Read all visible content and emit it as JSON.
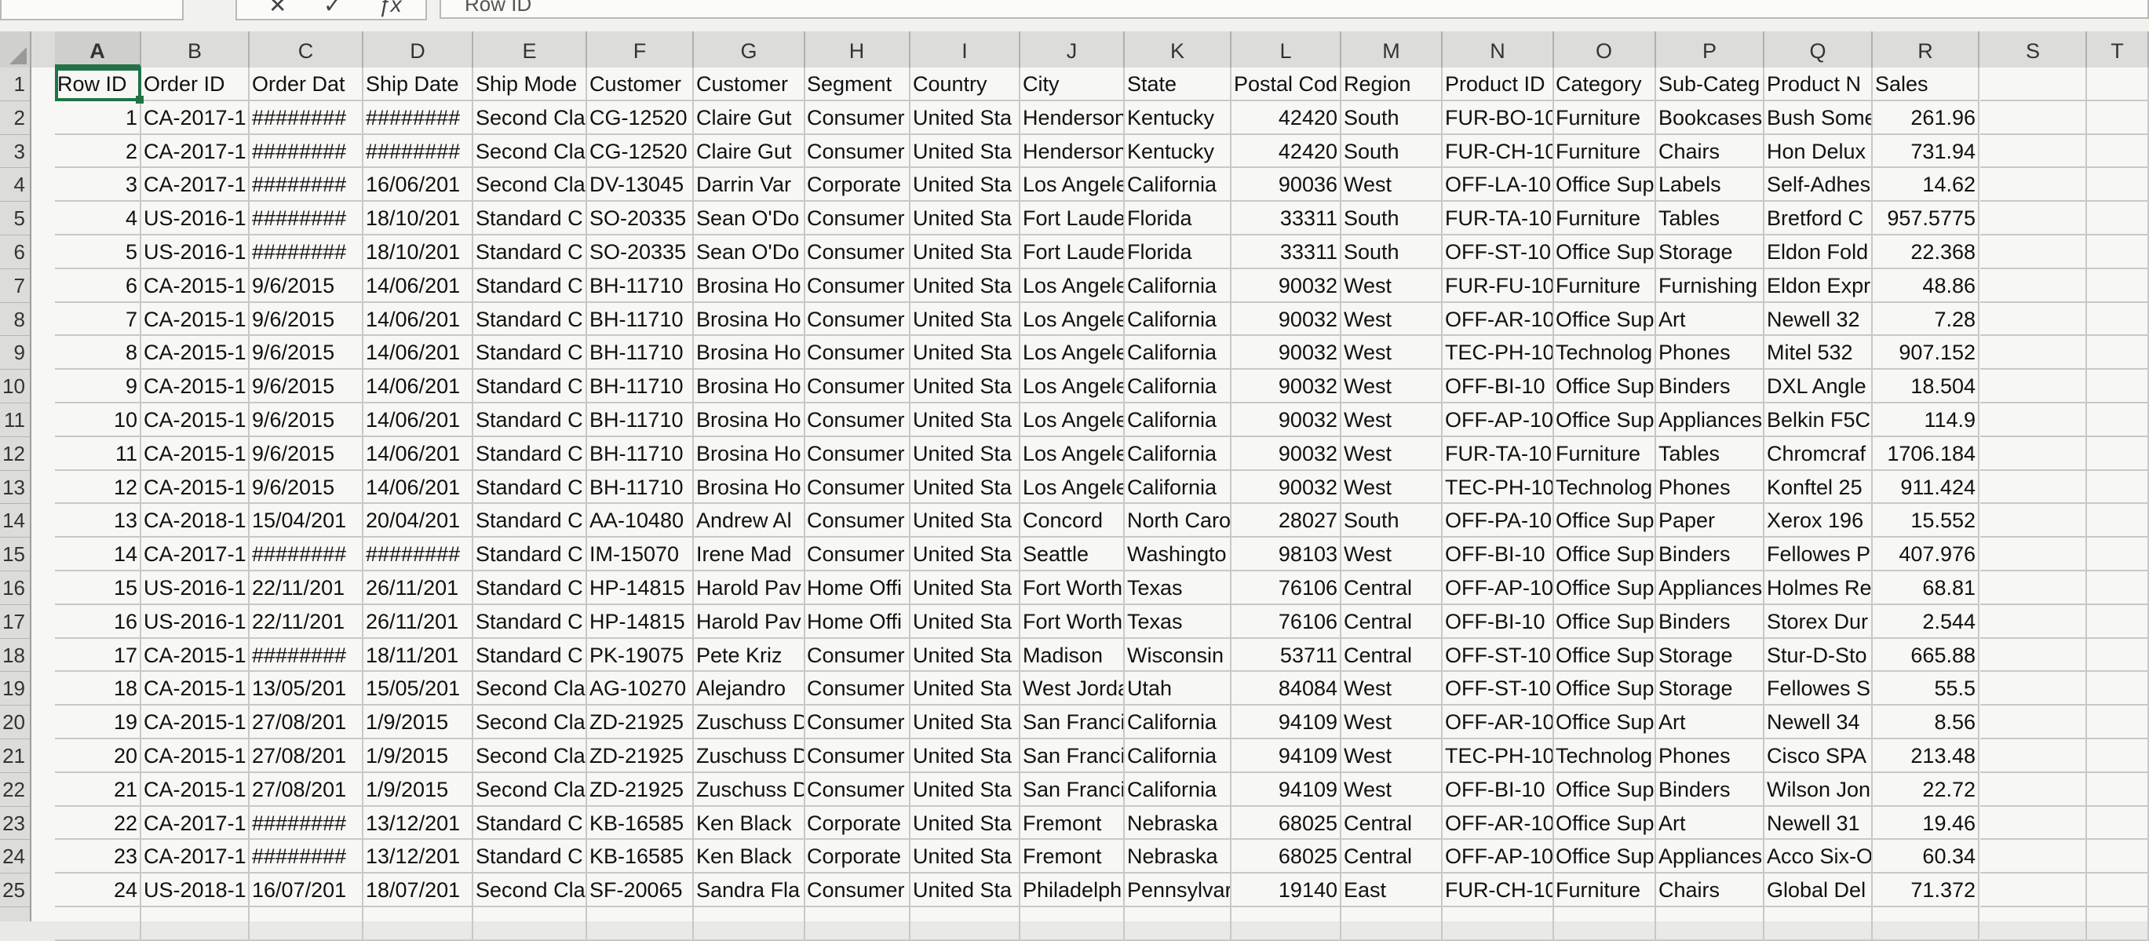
{
  "formula_bar": {
    "name_box": "",
    "formula_text": "Row ID"
  },
  "columns": [
    "A",
    "B",
    "C",
    "D",
    "E",
    "F",
    "G",
    "H",
    "I",
    "J",
    "K",
    "L",
    "M",
    "N",
    "O",
    "P",
    "Q",
    "R",
    "S",
    "T"
  ],
  "selected_column": "A",
  "active_cell": "A1",
  "rows": [
    [
      "Row ID",
      "Order ID",
      "Order Dat",
      "Ship Date",
      "Ship Mode",
      "Customer",
      "Customer",
      "Segment",
      "Country",
      "City",
      "State",
      "Postal Cod",
      "Region",
      "Product ID",
      "Category",
      "Sub-Categ",
      "Product N",
      "Sales"
    ],
    [
      "1",
      "CA-2017-1",
      "########",
      "########",
      "Second Cla",
      "CG-12520",
      "Claire Gut",
      "Consumer",
      "United Sta",
      "Henderson",
      "Kentucky",
      "42420",
      "South",
      "FUR-BO-10",
      "Furniture",
      "Bookcases",
      "Bush Some",
      "261.96"
    ],
    [
      "2",
      "CA-2017-1",
      "########",
      "########",
      "Second Cla",
      "CG-12520",
      "Claire Gut",
      "Consumer",
      "United Sta",
      "Henderson",
      "Kentucky",
      "42420",
      "South",
      "FUR-CH-10",
      "Furniture",
      "Chairs",
      "Hon Delux",
      "731.94"
    ],
    [
      "3",
      "CA-2017-1",
      "########",
      "16/06/201",
      "Second Cla",
      "DV-13045",
      "Darrin Var",
      "Corporate",
      "United Sta",
      "Los Angele",
      "California",
      "90036",
      "West",
      "OFF-LA-10",
      "Office Sup",
      "Labels",
      "Self-Adhes",
      "14.62"
    ],
    [
      "4",
      "US-2016-1",
      "########",
      "18/10/201",
      "Standard C",
      "SO-20335",
      "Sean O'Do",
      "Consumer",
      "United Sta",
      "Fort Laude",
      "Florida",
      "33311",
      "South",
      "FUR-TA-10",
      "Furniture",
      "Tables",
      "Bretford C",
      "957.5775"
    ],
    [
      "5",
      "US-2016-1",
      "########",
      "18/10/201",
      "Standard C",
      "SO-20335",
      "Sean O'Do",
      "Consumer",
      "United Sta",
      "Fort Laude",
      "Florida",
      "33311",
      "South",
      "OFF-ST-10",
      "Office Sup",
      "Storage",
      "Eldon Fold",
      "22.368"
    ],
    [
      "6",
      "CA-2015-1",
      "9/6/2015",
      "14/06/201",
      "Standard C",
      "BH-11710",
      "Brosina Ho",
      "Consumer",
      "United Sta",
      "Los Angele",
      "California",
      "90032",
      "West",
      "FUR-FU-10",
      "Furniture",
      "Furnishing",
      "Eldon Expr",
      "48.86"
    ],
    [
      "7",
      "CA-2015-1",
      "9/6/2015",
      "14/06/201",
      "Standard C",
      "BH-11710",
      "Brosina Ho",
      "Consumer",
      "United Sta",
      "Los Angele",
      "California",
      "90032",
      "West",
      "OFF-AR-10",
      "Office Sup",
      "Art",
      "Newell 32",
      "7.28"
    ],
    [
      "8",
      "CA-2015-1",
      "9/6/2015",
      "14/06/201",
      "Standard C",
      "BH-11710",
      "Brosina Ho",
      "Consumer",
      "United Sta",
      "Los Angele",
      "California",
      "90032",
      "West",
      "TEC-PH-10",
      "Technolog",
      "Phones",
      "Mitel 532",
      "907.152"
    ],
    [
      "9",
      "CA-2015-1",
      "9/6/2015",
      "14/06/201",
      "Standard C",
      "BH-11710",
      "Brosina Ho",
      "Consumer",
      "United Sta",
      "Los Angele",
      "California",
      "90032",
      "West",
      "OFF-BI-10",
      "Office Sup",
      "Binders",
      "DXL Angle",
      "18.504"
    ],
    [
      "10",
      "CA-2015-1",
      "9/6/2015",
      "14/06/201",
      "Standard C",
      "BH-11710",
      "Brosina Ho",
      "Consumer",
      "United Sta",
      "Los Angele",
      "California",
      "90032",
      "West",
      "OFF-AP-10",
      "Office Sup",
      "Appliances",
      "Belkin F5C",
      "114.9"
    ],
    [
      "11",
      "CA-2015-1",
      "9/6/2015",
      "14/06/201",
      "Standard C",
      "BH-11710",
      "Brosina Ho",
      "Consumer",
      "United Sta",
      "Los Angele",
      "California",
      "90032",
      "West",
      "FUR-TA-10",
      "Furniture",
      "Tables",
      "Chromcraf",
      "1706.184"
    ],
    [
      "12",
      "CA-2015-1",
      "9/6/2015",
      "14/06/201",
      "Standard C",
      "BH-11710",
      "Brosina Ho",
      "Consumer",
      "United Sta",
      "Los Angele",
      "California",
      "90032",
      "West",
      "TEC-PH-10",
      "Technolog",
      "Phones",
      "Konftel 25",
      "911.424"
    ],
    [
      "13",
      "CA-2018-1",
      "15/04/201",
      "20/04/201",
      "Standard C",
      "AA-10480",
      "Andrew Al",
      "Consumer",
      "United Sta",
      "Concord",
      "North Caro",
      "28027",
      "South",
      "OFF-PA-10",
      "Office Sup",
      "Paper",
      "Xerox 196",
      "15.552"
    ],
    [
      "14",
      "CA-2017-1",
      "########",
      "########",
      "Standard C",
      "IM-15070",
      "Irene Mad",
      "Consumer",
      "United Sta",
      "Seattle",
      "Washingto",
      "98103",
      "West",
      "OFF-BI-10",
      "Office Sup",
      "Binders",
      "Fellowes P",
      "407.976"
    ],
    [
      "15",
      "US-2016-1",
      "22/11/201",
      "26/11/201",
      "Standard C",
      "HP-14815",
      "Harold Pav",
      "Home Offi",
      "United Sta",
      "Fort Worth",
      "Texas",
      "76106",
      "Central",
      "OFF-AP-10",
      "Office Sup",
      "Appliances",
      "Holmes Re",
      "68.81"
    ],
    [
      "16",
      "US-2016-1",
      "22/11/201",
      "26/11/201",
      "Standard C",
      "HP-14815",
      "Harold Pav",
      "Home Offi",
      "United Sta",
      "Fort Worth",
      "Texas",
      "76106",
      "Central",
      "OFF-BI-10",
      "Office Sup",
      "Binders",
      "Storex Dur",
      "2.544"
    ],
    [
      "17",
      "CA-2015-1",
      "########",
      "18/11/201",
      "Standard C",
      "PK-19075",
      "Pete Kriz",
      "Consumer",
      "United Sta",
      "Madison",
      "Wisconsin",
      "53711",
      "Central",
      "OFF-ST-10",
      "Office Sup",
      "Storage",
      "Stur-D-Sto",
      "665.88"
    ],
    [
      "18",
      "CA-2015-1",
      "13/05/201",
      "15/05/201",
      "Second Cla",
      "AG-10270",
      "Alejandro",
      "Consumer",
      "United Sta",
      "West Jorda",
      "Utah",
      "84084",
      "West",
      "OFF-ST-10",
      "Office Sup",
      "Storage",
      "Fellowes S",
      "55.5"
    ],
    [
      "19",
      "CA-2015-1",
      "27/08/201",
      "1/9/2015",
      "Second Cla",
      "ZD-21925",
      "Zuschuss D",
      "Consumer",
      "United Sta",
      "San Franci",
      "California",
      "94109",
      "West",
      "OFF-AR-10",
      "Office Sup",
      "Art",
      "Newell 34",
      "8.56"
    ],
    [
      "20",
      "CA-2015-1",
      "27/08/201",
      "1/9/2015",
      "Second Cla",
      "ZD-21925",
      "Zuschuss D",
      "Consumer",
      "United Sta",
      "San Franci",
      "California",
      "94109",
      "West",
      "TEC-PH-10",
      "Technolog",
      "Phones",
      "Cisco SPA",
      "213.48"
    ],
    [
      "21",
      "CA-2015-1",
      "27/08/201",
      "1/9/2015",
      "Second Cla",
      "ZD-21925",
      "Zuschuss D",
      "Consumer",
      "United Sta",
      "San Franci",
      "California",
      "94109",
      "West",
      "OFF-BI-10",
      "Office Sup",
      "Binders",
      "Wilson Jon",
      "22.72"
    ],
    [
      "22",
      "CA-2017-1",
      "########",
      "13/12/201",
      "Standard C",
      "KB-16585",
      "Ken Black",
      "Corporate",
      "United Sta",
      "Fremont",
      "Nebraska",
      "68025",
      "Central",
      "OFF-AR-10",
      "Office Sup",
      "Art",
      "Newell 31",
      "19.46"
    ],
    [
      "23",
      "CA-2017-1",
      "########",
      "13/12/201",
      "Standard C",
      "KB-16585",
      "Ken Black",
      "Corporate",
      "United Sta",
      "Fremont",
      "Nebraska",
      "68025",
      "Central",
      "OFF-AP-10",
      "Office Sup",
      "Appliances",
      "Acco Six-O",
      "60.34"
    ],
    [
      "24",
      "US-2018-1",
      "16/07/201",
      "18/07/201",
      "Second Cla",
      "SF-20065",
      "Sandra Fla",
      "Consumer",
      "United Sta",
      "Philadelph",
      "Pennsylvar",
      "19140",
      "East",
      "FUR-CH-10",
      "Furniture",
      "Chairs",
      "Global Del",
      "71.372"
    ]
  ],
  "row_numbers": [
    "1",
    "2",
    "3",
    "4",
    "5",
    "6",
    "7",
    "8",
    "9",
    "10",
    "11",
    "12",
    "13",
    "14",
    "15",
    "16",
    "17",
    "18",
    "19",
    "20",
    "21",
    "22",
    "23",
    "24",
    "25"
  ]
}
